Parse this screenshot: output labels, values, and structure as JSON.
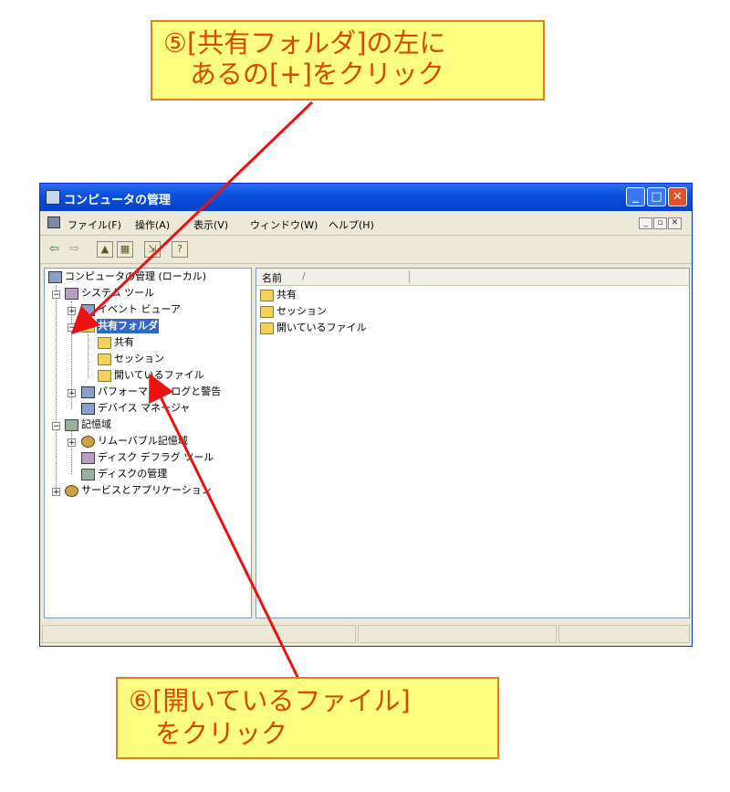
{
  "callouts": {
    "top": "⑤[共有フォルダ]の左に\n　あるの[+]をクリック",
    "bottom": "⑥[開いているファイル]\n　をクリック"
  },
  "window": {
    "title": "コンピュータの管理",
    "buttons": {
      "minimize": "_",
      "maximize": "□",
      "close": "✕"
    },
    "menu": [
      "ファイル(F)",
      "操作(A)",
      "表示(V)",
      "ウィンドウ(W)",
      "ヘルプ(H)"
    ],
    "mdi_controls": [
      "_",
      "▫",
      "✕"
    ]
  },
  "toolbar": {
    "back": "⇦",
    "forward": "⇨",
    "buttons": [
      "up-folder",
      "show-tree",
      "export",
      "help"
    ]
  },
  "tree": {
    "root": "コンピュータの管理 (ローカル)",
    "system_tools": "システム ツール",
    "event_viewer": "イベント ビューア",
    "shared_folders": "共有フォルダ",
    "shares": "共有",
    "sessions": "セッション",
    "open_files": "開いているファイル",
    "perf_logs": "パフォーマンス ログと警告",
    "device_manager": "デバイス マネージャ",
    "storage": "記憶域",
    "removable_storage": "リムーバブル記憶域",
    "defrag": "ディスク デフラグ ツール",
    "disk_mgmt": "ディスクの管理",
    "services_apps": "サービスとアプリケーション"
  },
  "list": {
    "column_name": "名前",
    "sort_indicator": "/",
    "items": [
      "共有",
      "セッション",
      "開いているファイル"
    ]
  },
  "colors": {
    "callout_bg": "#ffff80",
    "callout_text": "#d84800",
    "arrow": "#ee1111",
    "selection": "#316ac5"
  }
}
